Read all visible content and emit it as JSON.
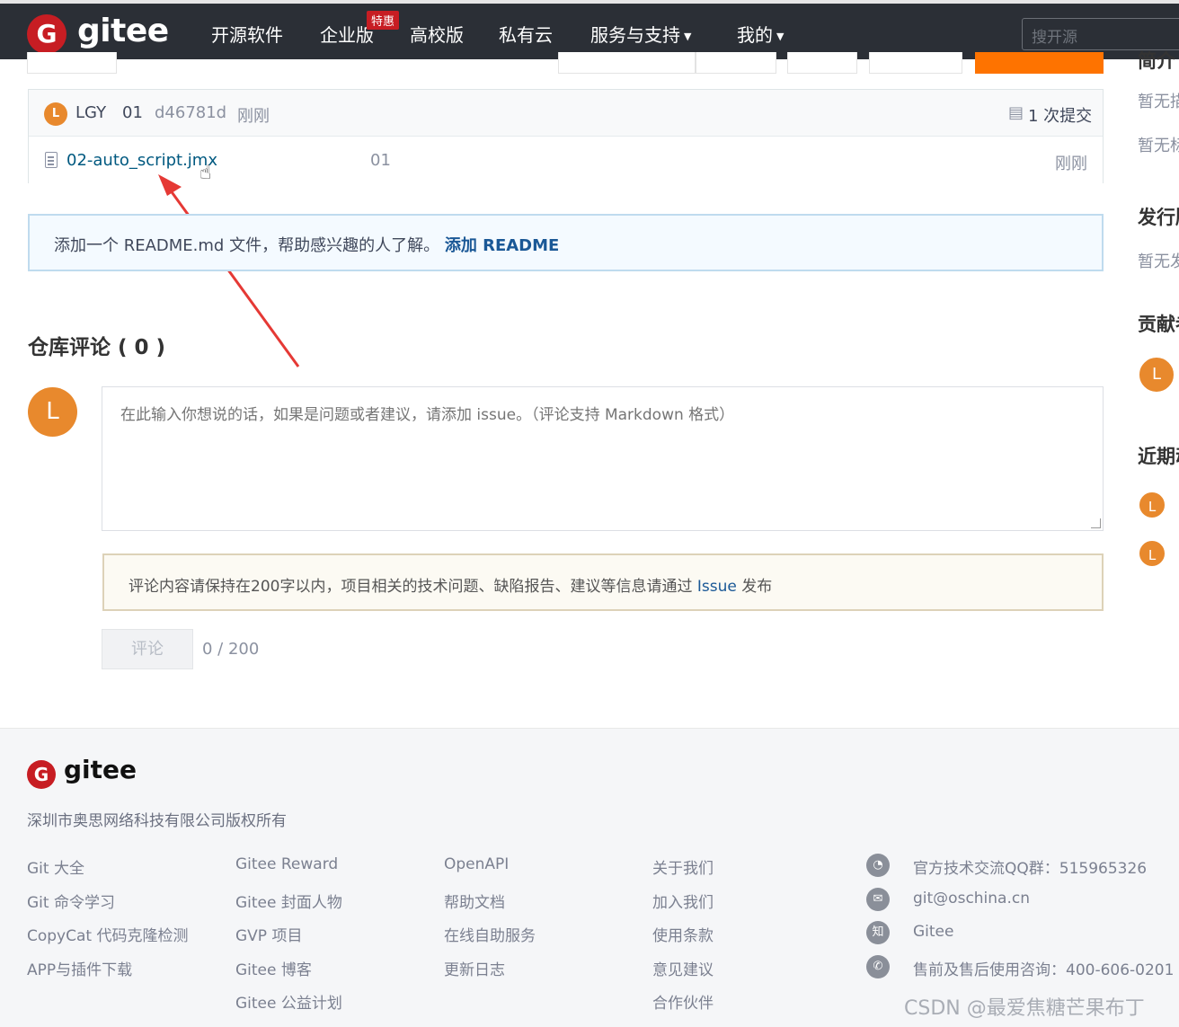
{
  "header": {
    "logo_mark": "G",
    "logo_text": "gitee",
    "nav": [
      {
        "label": "开源软件"
      },
      {
        "label": "企业版"
      },
      {
        "label": "高校版"
      },
      {
        "label": "私有云"
      },
      {
        "label": "服务与支持"
      },
      {
        "label": "我的"
      }
    ],
    "promo_badge": "特惠",
    "search_placeholder": "搜开源"
  },
  "commit": {
    "author_initial": "L",
    "author": "LGY",
    "message": "01",
    "hash": "d46781d",
    "time": "刚刚",
    "commit_count": "1 次提交"
  },
  "files": [
    {
      "name": "02-auto_script.jmx",
      "message": "01",
      "time": "刚刚"
    }
  ],
  "readme_tip": {
    "text": "添加一个 README.md 文件，帮助感兴趣的人了解。",
    "action": "添加 README"
  },
  "comments": {
    "title": "仓库评论 ( 0 )",
    "avatar_initial": "L",
    "placeholder": "在此输入你想说的话，如果是问题或者建议，请添加 issue。（评论支持 Markdown 格式）",
    "notice_prefix": "评论内容请保持在200字以内，项目相关的技术问题、缺陷报告、建议等信息请通过",
    "notice_link": "Issue",
    "notice_suffix": "发布",
    "submit_label": "评论",
    "counter": "0 / 200"
  },
  "sidebar": {
    "items": [
      {
        "text": "简介"
      },
      {
        "text": "暂无描述"
      },
      {
        "text": "暂无标签"
      },
      {
        "text": "发行版"
      },
      {
        "text": "暂无发行版"
      },
      {
        "text": "贡献者"
      },
      {
        "text": "近期动态"
      }
    ],
    "avatar_initial": "L"
  },
  "footer": {
    "logo_text": "gitee",
    "copyright": "深圳市奥思网络科技有限公司版权所有",
    "col1": [
      "Git 大全",
      "Git 命令学习",
      "CopyCat 代码克隆检测",
      "APP与插件下载"
    ],
    "col2": [
      "Gitee Reward",
      "Gitee 封面人物",
      "GVP 项目",
      "Gitee 博客",
      "Gitee 公益计划"
    ],
    "col3": [
      "OpenAPI",
      "帮助文档",
      "在线自助服务",
      "更新日志"
    ],
    "col4": [
      "关于我们",
      "加入我们",
      "使用条款",
      "意见建议",
      "合作伙伴"
    ],
    "contacts": [
      {
        "icon": "qq-icon",
        "text": "官方技术交流QQ群：515965326"
      },
      {
        "icon": "mail-icon",
        "text": "git@oschina.cn"
      },
      {
        "icon": "zhihu-icon",
        "glyph": "知",
        "text": "Gitee"
      },
      {
        "icon": "phone-icon",
        "text": "售前及售后使用咨询：400-606-0201"
      }
    ]
  },
  "watermark": "CSDN @最爱焦糖芒果布丁"
}
